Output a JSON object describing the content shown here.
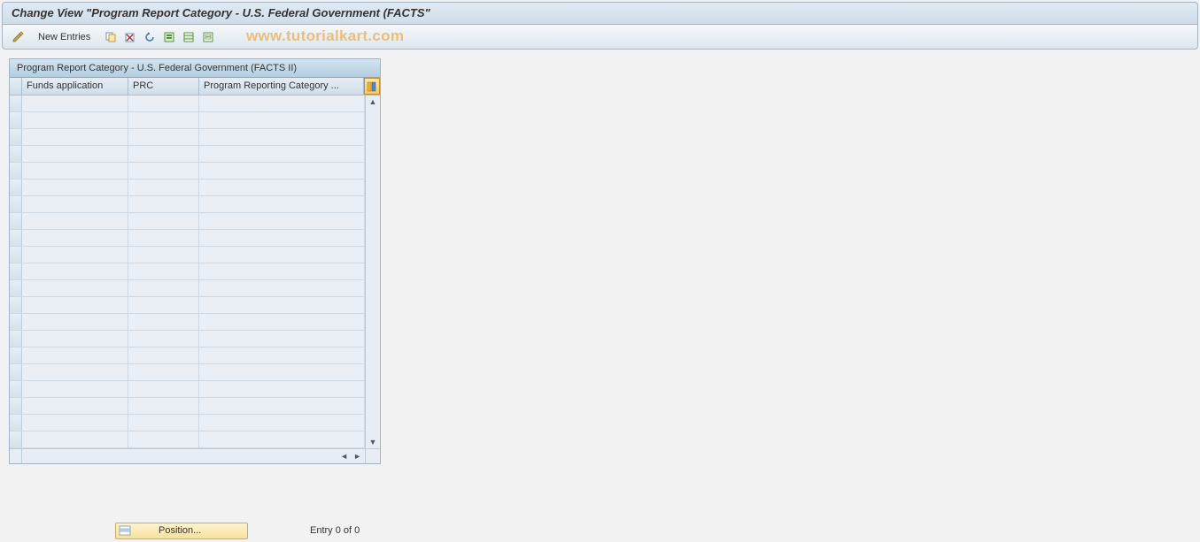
{
  "title": "Change View \"Program Report Category - U.S. Federal Government (FACTS\"",
  "toolbar": {
    "new_entries_label": "New Entries"
  },
  "watermark": "www.tutorialkart.com",
  "table": {
    "panel_title": "Program Report Category - U.S. Federal Government (FACTS II)",
    "columns": {
      "funds": "Funds application",
      "prc": "PRC",
      "desc": "Program Reporting Category  ..."
    },
    "row_count": 21
  },
  "footer": {
    "position_label": "Position...",
    "entry_status": "Entry 0 of 0"
  }
}
